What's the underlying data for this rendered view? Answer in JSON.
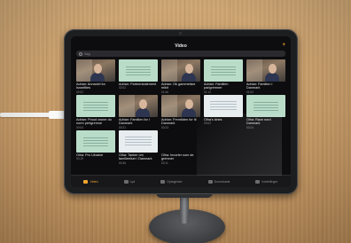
{
  "nav": {
    "title": "Video",
    "add_icon": "plus-icon"
  },
  "search": {
    "placeholder": "Søg"
  },
  "videos": [
    {
      "kind": "people",
      "title": "Adrian: Annaviel for Israelities",
      "duration": "02:02"
    },
    {
      "kind": "mint",
      "title": "Adrian: Partnerstatement",
      "duration": "02:02"
    },
    {
      "kind": "people",
      "title": "Adrian: Ok gammelske mikit",
      "duration": "01:46"
    },
    {
      "kind": "mint",
      "title": "Adrian: Familien parlgremner",
      "duration": "01:12"
    },
    {
      "kind": "people",
      "title": "Adrian: Familien i Danmark",
      "duration": "01:02"
    },
    {
      "kind": "mint",
      "title": "Adrian: Proud owner do norm pertgremne",
      "duration": "00:04"
    },
    {
      "kind": "people",
      "title": "Adrian: Familien for i Danmark",
      "duration": "00:21"
    },
    {
      "kind": "people",
      "title": "Adrian: Fremtiden for til Danmark",
      "duration": "00:23"
    },
    {
      "kind": "white",
      "title": "Olha's kines",
      "duration": "00:02"
    },
    {
      "kind": "mint",
      "title": "Olha: Race nord Danmark",
      "duration": "00:24"
    },
    {
      "kind": "mint",
      "title": "Olha: Pro Ukraine",
      "duration": "00:19"
    },
    {
      "kind": "white",
      "title": "Olha: Tanker om familieelser i Danmark",
      "duration": "00:36"
    },
    {
      "kind": "blank",
      "title": "Olha: Invorter som de gremner",
      "duration": "00:11"
    },
    {
      "kind": "blank",
      "title": "",
      "duration": ""
    },
    {
      "kind": "blank",
      "title": "",
      "duration": ""
    }
  ],
  "tabs": [
    {
      "label": "Video",
      "active": true,
      "icon": "video-icon"
    },
    {
      "label": "Lyd",
      "active": false,
      "icon": "audio-icon"
    },
    {
      "label": "Optagelser",
      "active": false,
      "icon": "recordings-icon"
    },
    {
      "label": "Downloads",
      "active": false,
      "icon": "download-icon"
    },
    {
      "label": "Indstillinger",
      "active": false,
      "icon": "settings-icon"
    }
  ],
  "colors": {
    "accent": "#f0a530",
    "tile_mint": "#b9dcc9",
    "wood": "#c79e6c"
  }
}
